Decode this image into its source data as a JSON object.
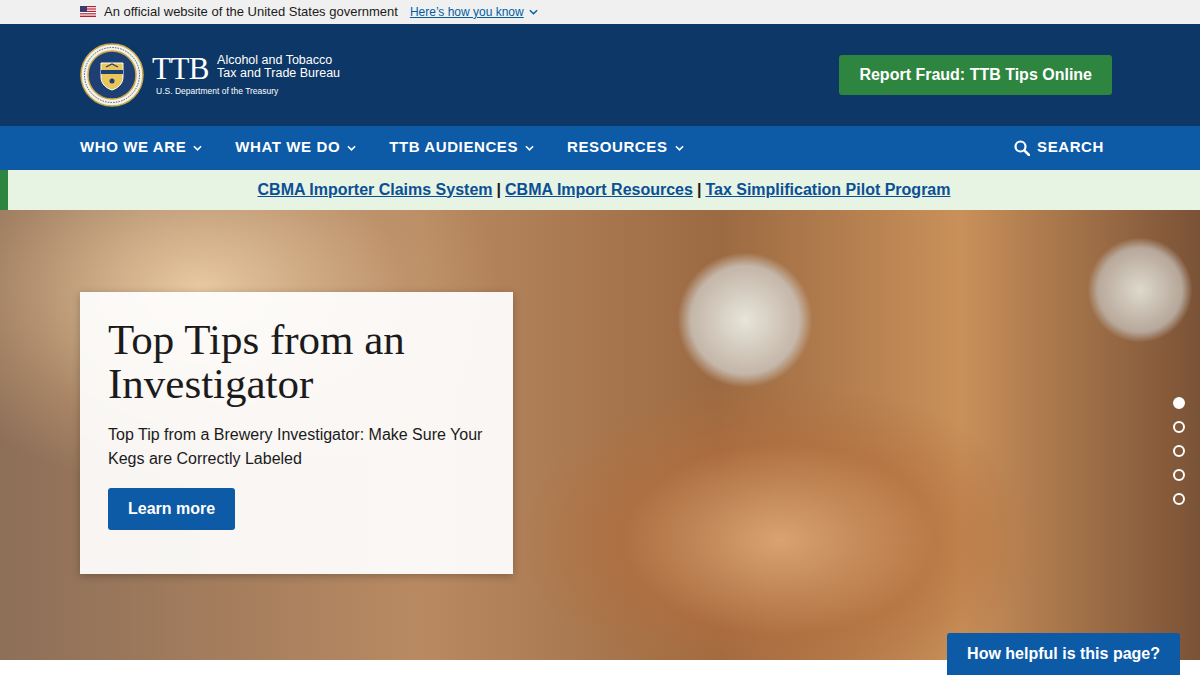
{
  "banner": {
    "text": "An official website of the United States government",
    "link": "Here’s how you know"
  },
  "header": {
    "logo_title": "TTB",
    "logo_line1": "Alcohol and Tobacco",
    "logo_line2": "Tax and Trade Bureau",
    "logo_line3": "U.S. Department of the Treasury",
    "report_button": "Report Fraud: TTB Tips Online"
  },
  "nav": {
    "items": [
      "WHO WE ARE",
      "WHAT WE DO",
      "TTB AUDIENCES",
      "RESOURCES"
    ],
    "search": "SEARCH"
  },
  "alert": {
    "links": [
      "CBMA Importer Claims System",
      "CBMA Import Resources",
      "Tax Simplification Pilot Program"
    ],
    "separator": "|"
  },
  "hero": {
    "title": "Top Tips from an Investigator",
    "text": "Top Tip from a Brewery Investigator: Make Sure Your Kegs are Correctly Labeled",
    "button": "Learn more",
    "slides": [
      {
        "selected": true
      },
      {
        "selected": false
      },
      {
        "selected": false
      },
      {
        "selected": false
      },
      {
        "selected": false
      }
    ]
  },
  "feedback": {
    "label": "How helpful is this page?"
  }
}
